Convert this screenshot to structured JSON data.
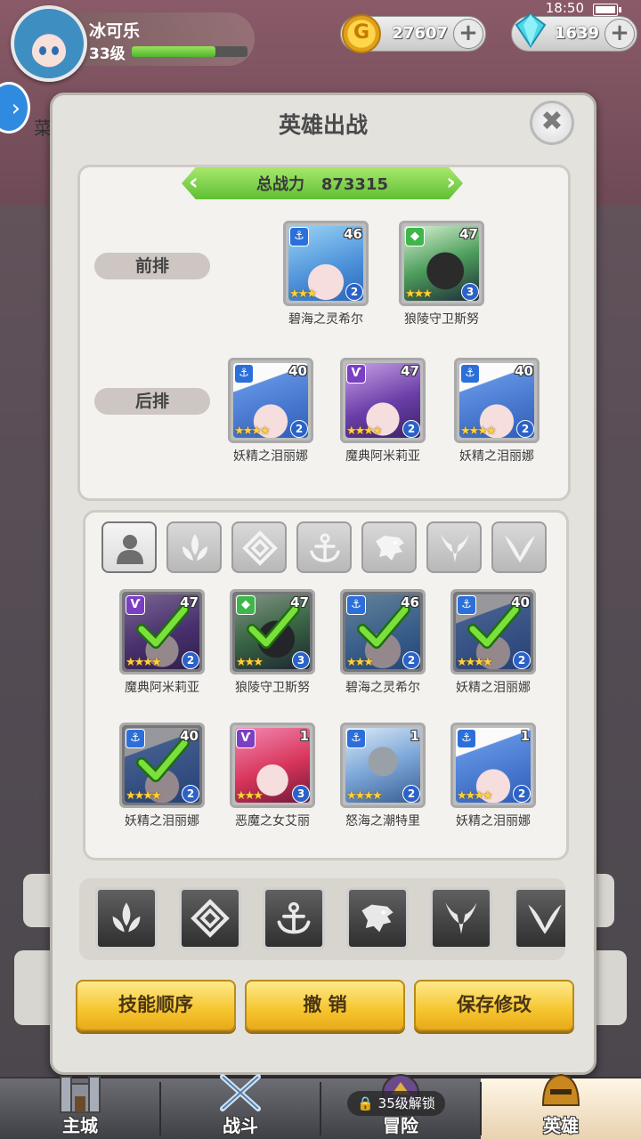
{
  "status_bar": {
    "time": "18:50"
  },
  "player": {
    "name": "冰可乐",
    "level": "33级",
    "exp_fraction": 0.72
  },
  "currency": {
    "gold": "27607",
    "gems": "1639"
  },
  "behind_tab_fragment": "菜",
  "dialog": {
    "title": "英雄出战",
    "total_power_label": "总战力",
    "total_power_value": "873315",
    "front_row_label": "前排",
    "back_row_label": "后排"
  },
  "lineup": {
    "front": [
      {
        "name": "碧海之灵希尔",
        "level": "46",
        "tier": "2",
        "stars": "★★★",
        "faction": "anchor-icon",
        "art": "blue"
      },
      {
        "name": "狼陵守卫斯努",
        "level": "47",
        "tier": "3",
        "stars": "★★★",
        "faction": "beast-icon",
        "art": "dark"
      }
    ],
    "back": [
      {
        "name": "妖精之泪丽娜",
        "level": "40",
        "tier": "2",
        "stars": "★★★★",
        "faction": "anchor-icon",
        "art": "fairy"
      },
      {
        "name": "魔典阿米莉亚",
        "level": "47",
        "tier": "2",
        "stars": "★★★★",
        "faction": "demon-icon",
        "art": "purple"
      },
      {
        "name": "妖精之泪丽娜",
        "level": "40",
        "tier": "2",
        "stars": "★★★★",
        "faction": "anchor-icon",
        "art": "fairy"
      }
    ]
  },
  "filters": [
    "all-heroes-icon",
    "leaf-class-icon",
    "diamond-class-icon",
    "anchor-icon",
    "beast-icon",
    "demon-icon",
    "wing-class-icon"
  ],
  "roster": [
    {
      "name": "魔典阿米莉亚",
      "level": "47",
      "tier": "2",
      "stars": "★★★★",
      "faction": "demon-icon",
      "art": "purple",
      "selected": true
    },
    {
      "name": "狼陵守卫斯努",
      "level": "47",
      "tier": "3",
      "stars": "★★★",
      "faction": "beast-icon",
      "art": "dark",
      "selected": true
    },
    {
      "name": "碧海之灵希尔",
      "level": "46",
      "tier": "2",
      "stars": "★★★",
      "faction": "anchor-icon",
      "art": "blue",
      "selected": true
    },
    {
      "name": "妖精之泪丽娜",
      "level": "40",
      "tier": "2",
      "stars": "★★★★",
      "faction": "anchor-icon",
      "art": "fairy",
      "selected": true
    },
    {
      "name": "妖精之泪丽娜",
      "level": "40",
      "tier": "2",
      "stars": "★★★★",
      "faction": "anchor-icon",
      "art": "fairy",
      "selected": true
    },
    {
      "name": "恶魔之女艾丽",
      "level": "1",
      "tier": "3",
      "stars": "★★★",
      "faction": "demon-icon",
      "art": "red",
      "selected": false
    },
    {
      "name": "怒海之潮特里",
      "level": "1",
      "tier": "2",
      "stars": "★★★★",
      "faction": "anchor-icon",
      "art": "knight",
      "selected": false
    },
    {
      "name": "妖精之泪丽娜",
      "level": "1",
      "tier": "2",
      "stars": "★★★★",
      "faction": "anchor-icon",
      "art": "fairy",
      "selected": false
    }
  ],
  "class_strip": [
    "leaf-class-icon",
    "diamond-class-icon",
    "anchor-icon",
    "beast-icon",
    "demon-icon",
    "wing-class-icon"
  ],
  "actions": {
    "skill_order": "技能顺序",
    "undo": "撤 销",
    "save": "保存修改"
  },
  "nav": {
    "items": [
      {
        "label": "主城",
        "icon": "castle-icon"
      },
      {
        "label": "战斗",
        "icon": "crossed-swords-icon"
      },
      {
        "label": "冒险",
        "icon": "adventure-icon"
      },
      {
        "label": "英雄",
        "icon": "helmet-icon"
      }
    ],
    "lock_text": "35级解锁"
  }
}
